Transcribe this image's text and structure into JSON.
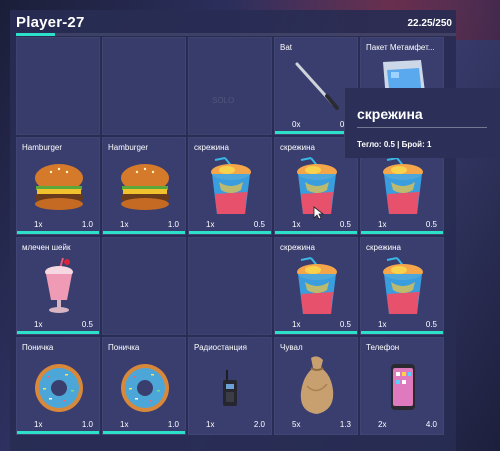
{
  "inventory": {
    "title": "Player-27",
    "weight": "22.25/250",
    "weight_fill": 0.089
  },
  "slots": [
    {
      "name": "",
      "qty": "",
      "wt": "",
      "icon": "",
      "bar": false
    },
    {
      "name": "",
      "qty": "",
      "wt": "",
      "icon": "",
      "bar": false
    },
    {
      "name": "",
      "qty": "",
      "wt": "",
      "icon": "",
      "bar": false
    },
    {
      "name": "Bat",
      "qty": "0x",
      "wt": "0.0",
      "icon": "bat-icon",
      "bar": true
    },
    {
      "name": "Пакет Метамфет...",
      "qty": "",
      "wt": "",
      "icon": "meth-bag-icon",
      "bar": false
    },
    {
      "name": "Hamburger",
      "qty": "1x",
      "wt": "1.0",
      "icon": "hamburger-icon",
      "bar": true
    },
    {
      "name": "Hamburger",
      "qty": "1x",
      "wt": "1.0",
      "icon": "hamburger-icon",
      "bar": true
    },
    {
      "name": "скрежина",
      "qty": "1x",
      "wt": "0.5",
      "icon": "slushie-icon",
      "bar": true
    },
    {
      "name": "скрежина",
      "qty": "1x",
      "wt": "0.5",
      "icon": "slushie-icon",
      "bar": true
    },
    {
      "name": "",
      "qty": "1x",
      "wt": "0.5",
      "icon": "slushie-icon",
      "bar": true
    },
    {
      "name": "млечен шейк",
      "qty": "1x",
      "wt": "0.5",
      "icon": "milkshake-icon",
      "bar": true
    },
    {
      "name": "",
      "qty": "",
      "wt": "",
      "icon": "",
      "bar": false
    },
    {
      "name": "",
      "qty": "",
      "wt": "",
      "icon": "",
      "bar": false
    },
    {
      "name": "скрежина",
      "qty": "1x",
      "wt": "0.5",
      "icon": "slushie-icon",
      "bar": true
    },
    {
      "name": "скрежина",
      "qty": "1x",
      "wt": "0.5",
      "icon": "slushie-icon",
      "bar": true
    },
    {
      "name": "Поничка",
      "qty": "1x",
      "wt": "1.0",
      "icon": "donut-icon",
      "bar": true
    },
    {
      "name": "Поничка",
      "qty": "1x",
      "wt": "1.0",
      "icon": "donut-icon",
      "bar": true
    },
    {
      "name": "Радиостанция",
      "qty": "1x",
      "wt": "2.0",
      "icon": "radio-icon",
      "bar": false
    },
    {
      "name": "Чувал",
      "qty": "5x",
      "wt": "1.3",
      "icon": "sack-icon",
      "bar": false
    },
    {
      "name": "Телефон",
      "qty": "2x",
      "wt": "4.0",
      "icon": "phone-icon",
      "bar": false
    }
  ],
  "tooltip": {
    "title": "скрежина",
    "info": "Тегло: 0.5 | Брой: 1"
  },
  "watermark": "SOLO",
  "colors": {
    "accent": "#2de0c8",
    "slot": "#3a3e6e",
    "panel": "#282c54"
  }
}
